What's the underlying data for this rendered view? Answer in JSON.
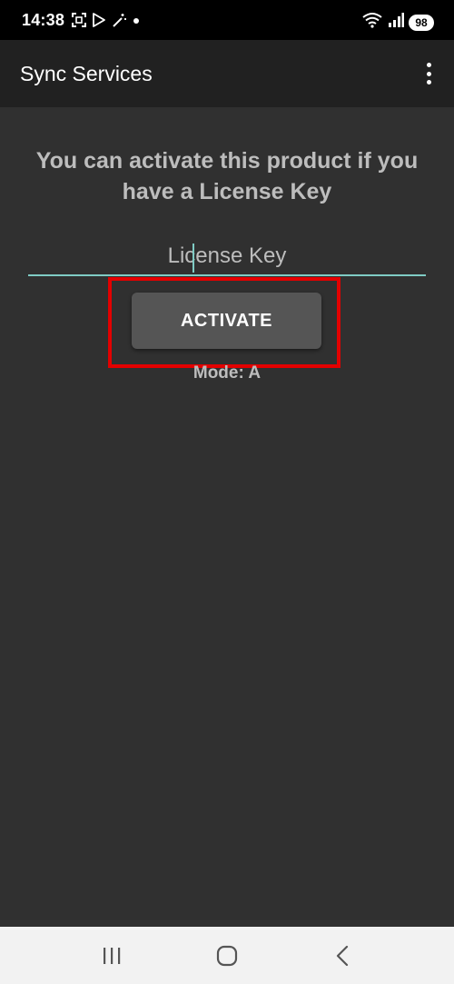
{
  "status_bar": {
    "time": "14:38",
    "battery_level": "98",
    "icons": [
      "screenshot-icon",
      "play-store-icon",
      "magic-wand-icon",
      "notification-dot-icon",
      "wifi-icon",
      "signal-icon"
    ]
  },
  "app_bar": {
    "title": "Sync Services",
    "menu_icon": "more-vert-icon"
  },
  "main": {
    "prompt": "You can activate this product if you have a License Key",
    "license_placeholder": "License Key",
    "license_value": "",
    "activate_label": "ACTIVATE",
    "mode_text": "Mode: A"
  },
  "nav_bar": {
    "icons": [
      "recents-icon",
      "home-icon",
      "back-icon"
    ]
  },
  "colors": {
    "background": "#303030",
    "app_bar": "#212121",
    "accent_underline": "#7fcbc4",
    "button": "#555555",
    "highlight": "#e30000",
    "text_muted": "#bdbdbd"
  }
}
